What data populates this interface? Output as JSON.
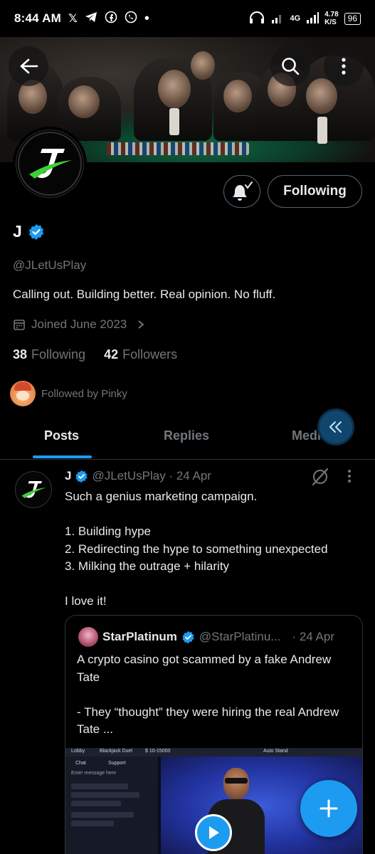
{
  "status_bar": {
    "time": "8:44 AM",
    "apps": [
      "x-icon",
      "telegram-icon",
      "facebook-icon",
      "whatsapp-icon"
    ],
    "network": "4G",
    "speed": "4.78",
    "speed_unit": "K/S",
    "battery": "96"
  },
  "profile": {
    "name": "J",
    "verified": true,
    "handle": "@JLetUsPlay",
    "bio": "Calling out. Building better. Real opinion. No fluff.",
    "joined": "Joined June 2023",
    "following_count": "38",
    "following_label": "Following",
    "followers_count": "42",
    "followers_label": "Followers",
    "followed_by": "Followed by Pinky",
    "follow_button_label": "Following"
  },
  "tabs": [
    {
      "label": "Posts",
      "active": true
    },
    {
      "label": "Replies",
      "active": false
    },
    {
      "label": "Medi",
      "active": false
    }
  ],
  "post": {
    "name": "J",
    "handle_time": "@JLetUsPlay · 24 Apr",
    "text": "Such a genius marketing campaign.\n\n1. Building hype\n2. Redirecting the hype to something unexpected\n3. Milking the outrage + hilarity\n\nI love it!",
    "quote": {
      "name": "StarPlatinum",
      "handle": "@StarPlatinu...",
      "time": "· 24 Apr",
      "text": "A crypto casino got scammed by a fake Andrew Tate\n\n- They “thought” they were hiring the real Andrew Tate ...",
      "media_labels": {
        "lobby": "Lobby",
        "game": "Blackjack Duel",
        "stakes": "$ 10-15000",
        "auto_stand": "Auto Stand",
        "chat": "Chat",
        "support": "Support",
        "message_placeholder": "Enter message here"
      }
    }
  },
  "colors": {
    "accent": "#1d9bf0",
    "muted": "#71767b",
    "text": "#e7e9ea",
    "border": "#2f3336",
    "background": "#000000"
  }
}
